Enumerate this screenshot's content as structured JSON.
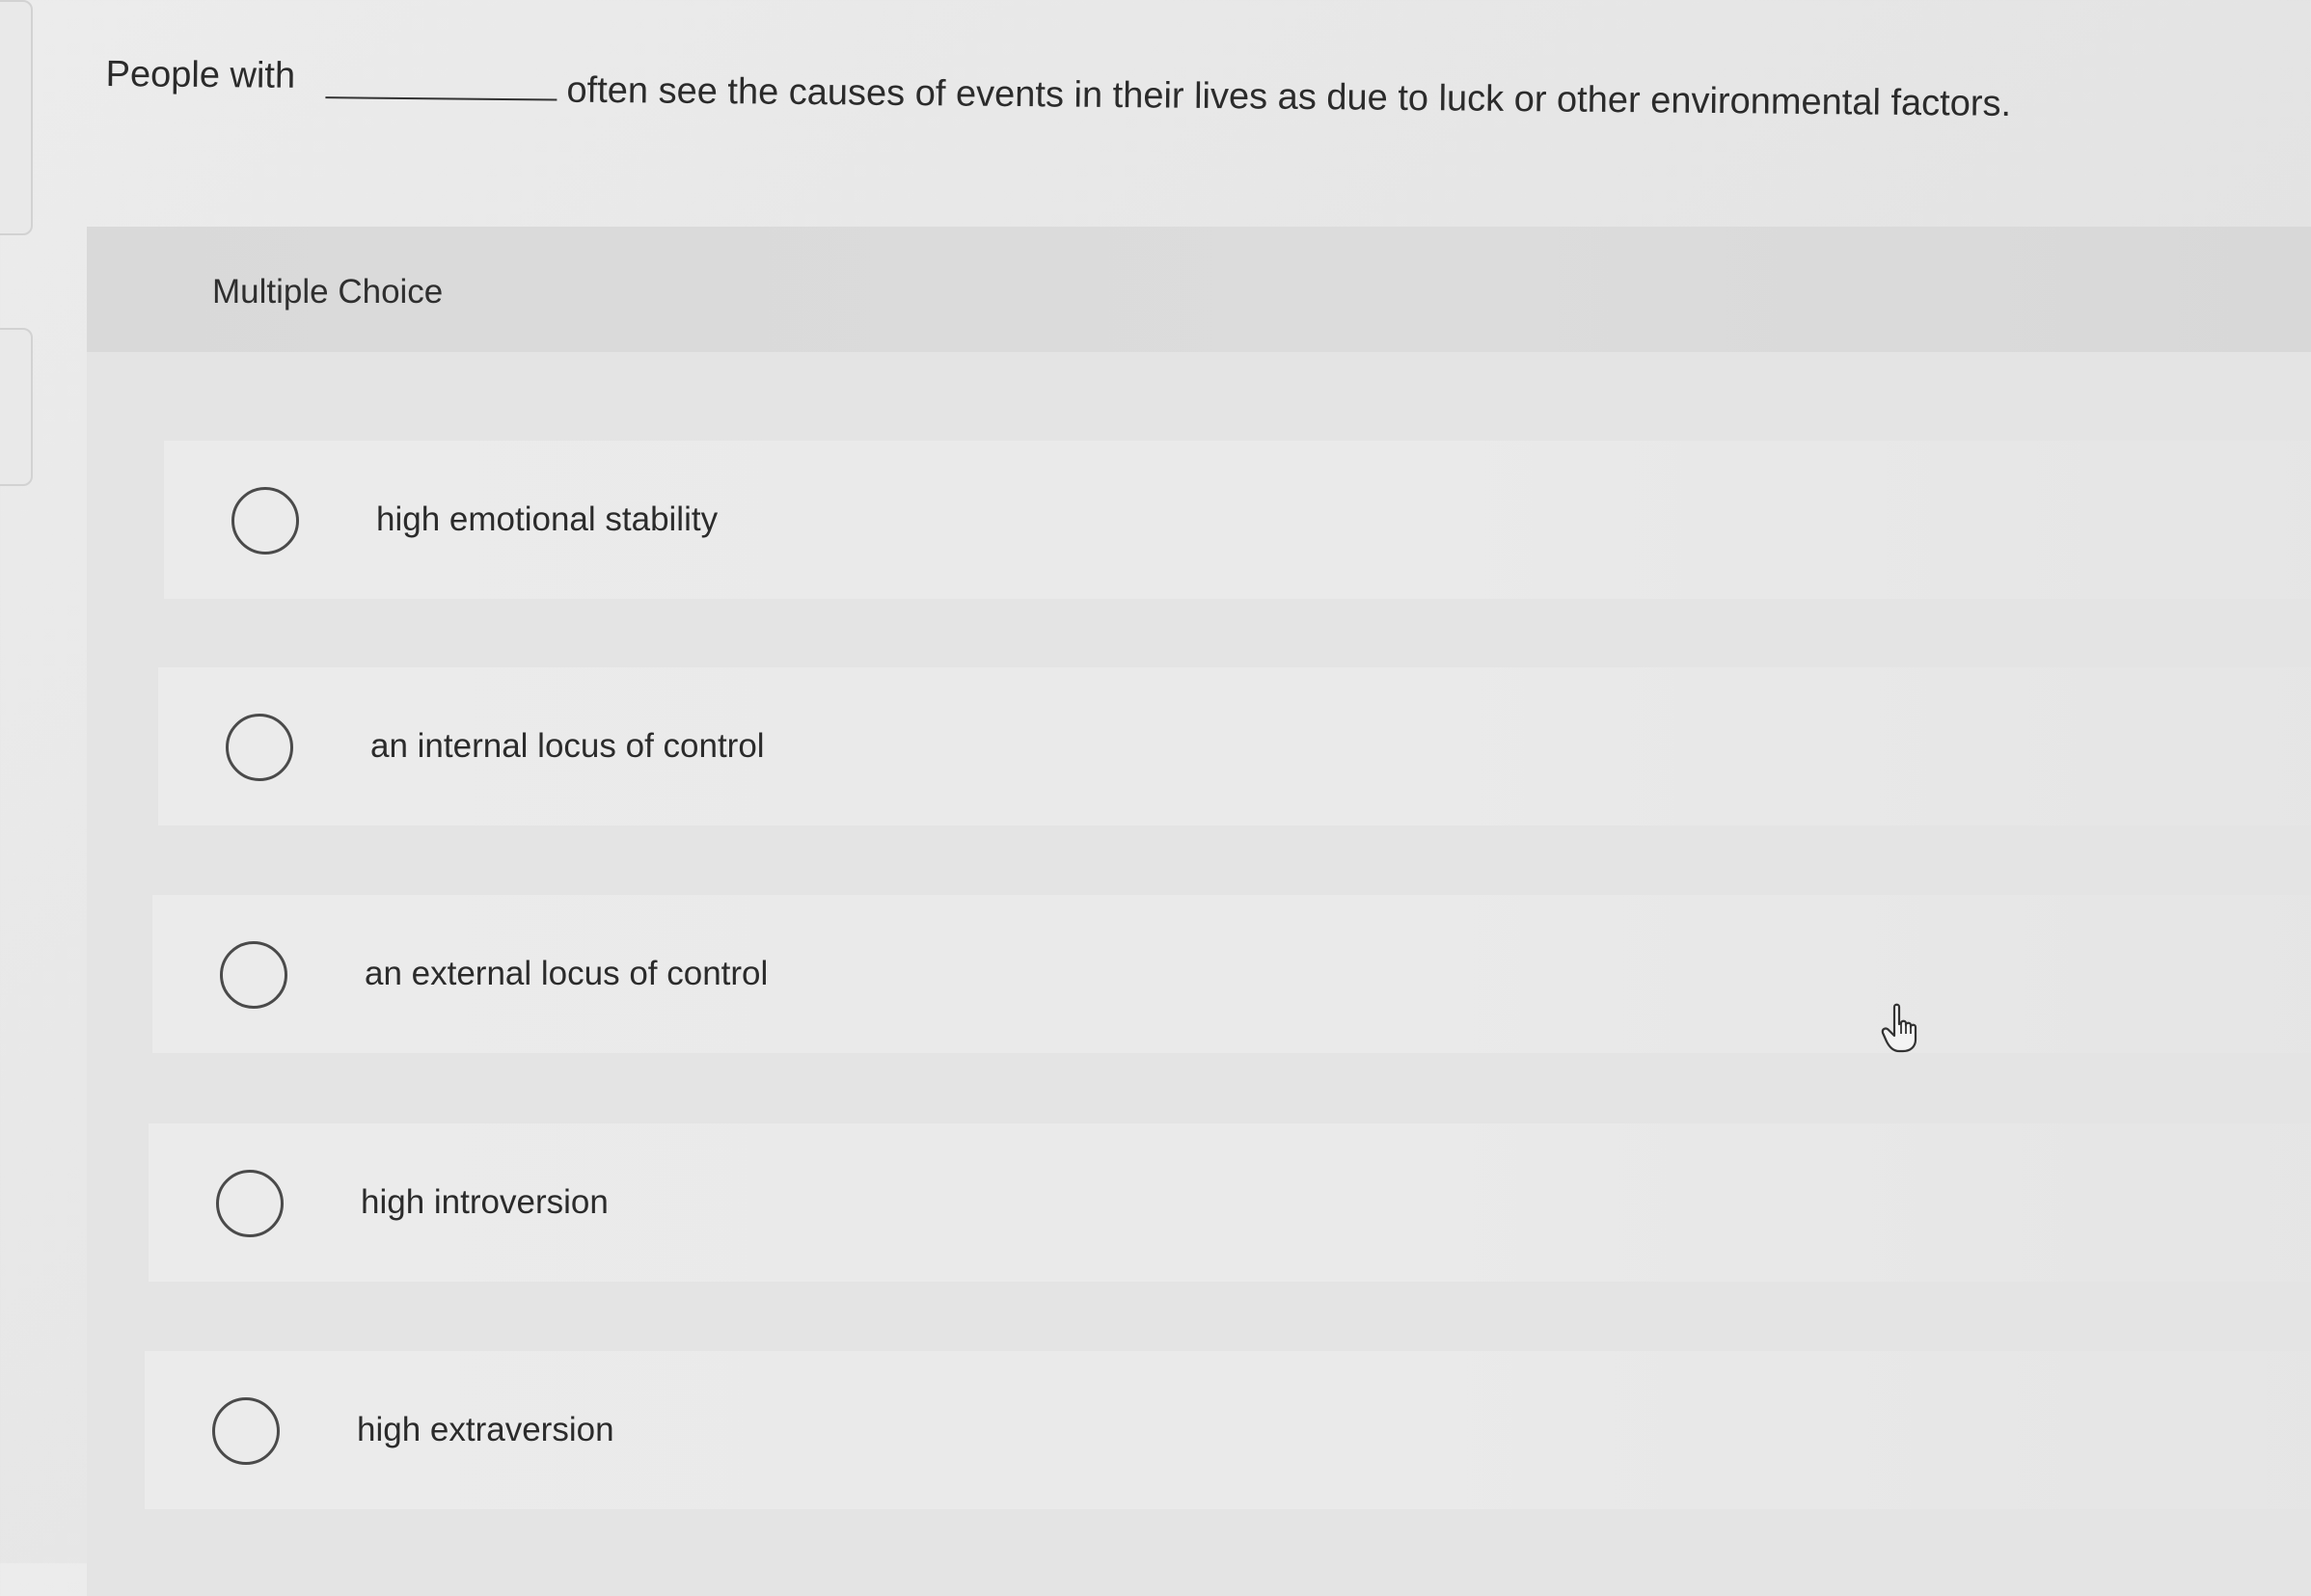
{
  "question": {
    "prefix": "People with",
    "suffix": "often see the causes of events in their lives as due to luck or other environmental factors."
  },
  "card": {
    "title": "Multiple Choice"
  },
  "options": [
    {
      "label": "high emotional stability"
    },
    {
      "label": "an internal locus of control"
    },
    {
      "label": "an external locus of control"
    },
    {
      "label": "high introversion"
    },
    {
      "label": "high extraversion"
    }
  ],
  "icons": {
    "radio": "radio-button-empty-icon",
    "cursor": "hand-pointer-cursor-icon"
  }
}
